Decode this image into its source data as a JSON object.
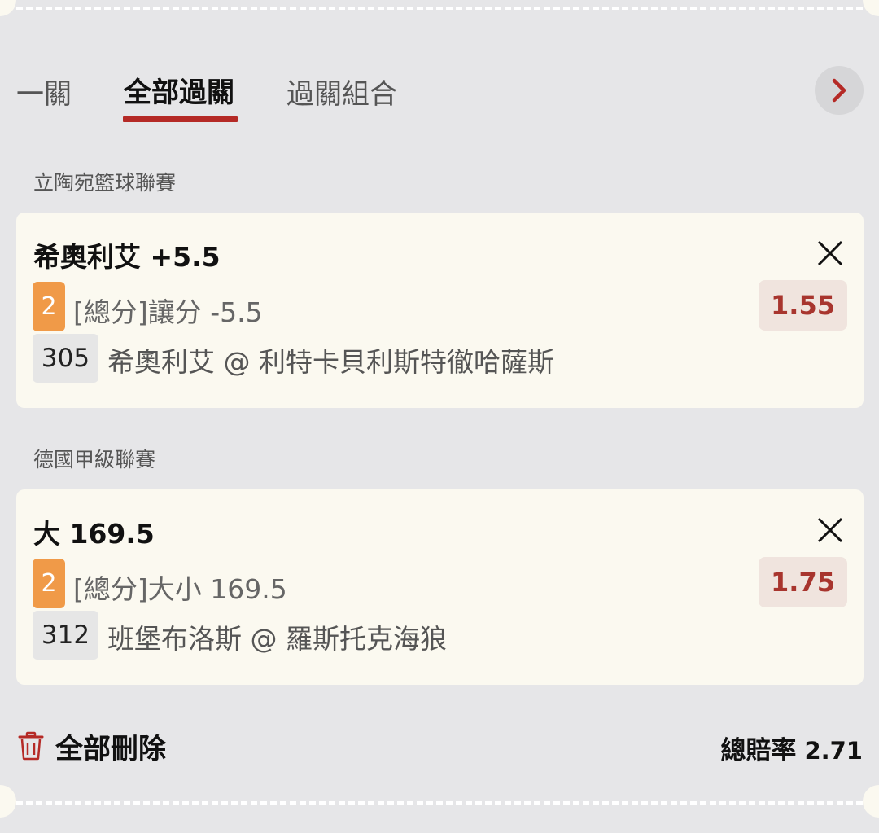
{
  "tabs": {
    "single": "一關",
    "parlay": "全部過關",
    "combo": "過關組合"
  },
  "icons": {
    "next": "chevron-right-icon",
    "close": "close-icon",
    "delete": "trash-icon"
  },
  "colors": {
    "accent": "#b52a26",
    "badge": "#f09a48",
    "odds_text": "#a8352e",
    "odds_bg": "#f0e4de",
    "card_bg": "#fbf9f0",
    "page_bg": "#e6e6e8"
  },
  "bets": [
    {
      "league": "立陶宛籃球聯賽",
      "selection": "希奧利艾 +5.5",
      "badge": "2",
      "market": "[總分]讓分 -5.5",
      "odds": "1.55",
      "code": "305",
      "match": "希奧利艾 @ 利特卡貝利斯特徹哈薩斯"
    },
    {
      "league": "德國甲級聯賽",
      "selection": "大 169.5",
      "badge": "2",
      "market": "[總分]大小 169.5",
      "odds": "1.75",
      "code": "312",
      "match": "班堡布洛斯 @ 羅斯托克海狼"
    }
  ],
  "footer": {
    "delete_label": "全部刪除",
    "total_label": "總賠率",
    "total_value": "2.71"
  }
}
